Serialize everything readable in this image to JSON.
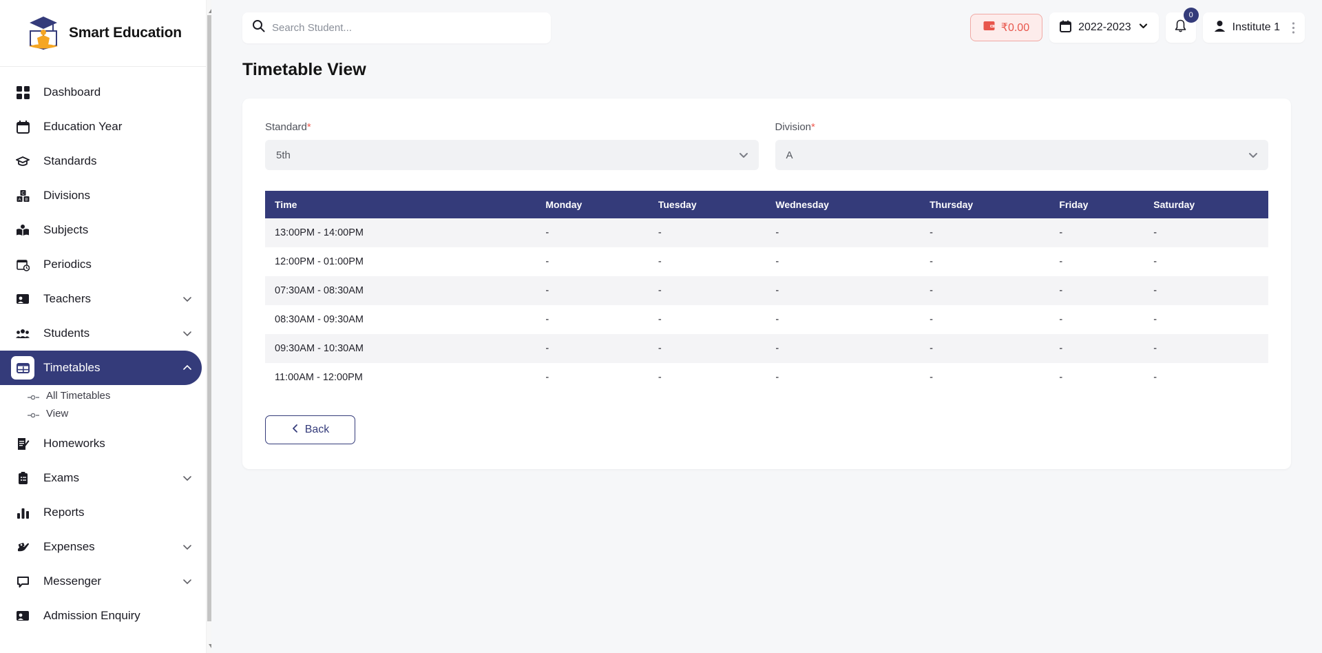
{
  "brand": {
    "title": "Smart Education",
    "logo_icon": "graduation-book-logo"
  },
  "sidebar": {
    "items": [
      {
        "label": "Dashboard",
        "icon": "grid-icon",
        "expandable": false,
        "active": false
      },
      {
        "label": "Education Year",
        "icon": "calendar-icon",
        "expandable": false,
        "active": false
      },
      {
        "label": "Standards",
        "icon": "graduation-cap-icon",
        "expandable": false,
        "active": false
      },
      {
        "label": "Divisions",
        "icon": "blocks-icon",
        "expandable": false,
        "active": false
      },
      {
        "label": "Subjects",
        "icon": "open-book-icon",
        "expandable": false,
        "active": false
      },
      {
        "label": "Periodics",
        "icon": "calendar-clock-icon",
        "expandable": false,
        "active": false
      },
      {
        "label": "Teachers",
        "icon": "presentation-person-icon",
        "expandable": true,
        "active": false
      },
      {
        "label": "Students",
        "icon": "people-group-icon",
        "expandable": true,
        "active": false
      },
      {
        "label": "Timetables",
        "icon": "table-grid-icon",
        "expandable": true,
        "active": true,
        "submenu": [
          {
            "label": "All Timetables"
          },
          {
            "label": "View"
          }
        ]
      },
      {
        "label": "Homeworks",
        "icon": "note-pencil-icon",
        "expandable": false,
        "active": false
      },
      {
        "label": "Exams",
        "icon": "clipboard-icon",
        "expandable": true,
        "active": false
      },
      {
        "label": "Reports",
        "icon": "bar-chart-icon",
        "expandable": false,
        "active": false
      },
      {
        "label": "Expenses",
        "icon": "hand-money-icon",
        "expandable": true,
        "active": false
      },
      {
        "label": "Messenger",
        "icon": "chat-bubble-icon",
        "expandable": true,
        "active": false
      },
      {
        "label": "Admission Enquiry",
        "icon": "presentation-person-icon",
        "expandable": false,
        "active": false
      }
    ]
  },
  "topbar": {
    "search": {
      "placeholder": "Search Student...",
      "value": "",
      "icon": "search-icon"
    },
    "wallet": {
      "amount": "₹0.00",
      "icon": "wallet-icon"
    },
    "year": {
      "value": "2022-2023",
      "icon": "calendar-icon",
      "caret": "chevron-down-icon"
    },
    "notifications": {
      "count": "0",
      "icon": "bell-icon"
    },
    "user": {
      "name": "Institute 1",
      "icon": "person-icon",
      "menu": "kebab-menu-icon"
    }
  },
  "page": {
    "title": "Timetable View",
    "form": {
      "standard": {
        "label": "Standard",
        "required": "*",
        "value": "5th"
      },
      "division": {
        "label": "Division",
        "required": "*",
        "value": "A"
      }
    },
    "table": {
      "headers": [
        "Time",
        "Monday",
        "Tuesday",
        "Wednesday",
        "Thursday",
        "Friday",
        "Saturday"
      ],
      "rows": [
        [
          "13:00PM - 14:00PM",
          "-",
          "-",
          "-",
          "-",
          "-",
          "-"
        ],
        [
          "12:00PM - 01:00PM",
          "-",
          "-",
          "-",
          "-",
          "-",
          "-"
        ],
        [
          "07:30AM - 08:30AM",
          "-",
          "-",
          "-",
          "-",
          "-",
          "-"
        ],
        [
          "08:30AM - 09:30AM",
          "-",
          "-",
          "-",
          "-",
          "-",
          "-"
        ],
        [
          "09:30AM - 10:30AM",
          "-",
          "-",
          "-",
          "-",
          "-",
          "-"
        ],
        [
          "11:00AM - 12:00PM",
          "-",
          "-",
          "-",
          "-",
          "-",
          "-"
        ]
      ]
    },
    "back_button": {
      "label": "Back",
      "icon": "chevron-left-icon"
    }
  },
  "colors": {
    "navy": "#343b7a",
    "page_bg": "#f6f7f9",
    "wallet_red": "#e8564c",
    "wallet_bg": "#fdeceb",
    "required_red": "#f05a4f",
    "row_alt": "#f4f4f6"
  }
}
